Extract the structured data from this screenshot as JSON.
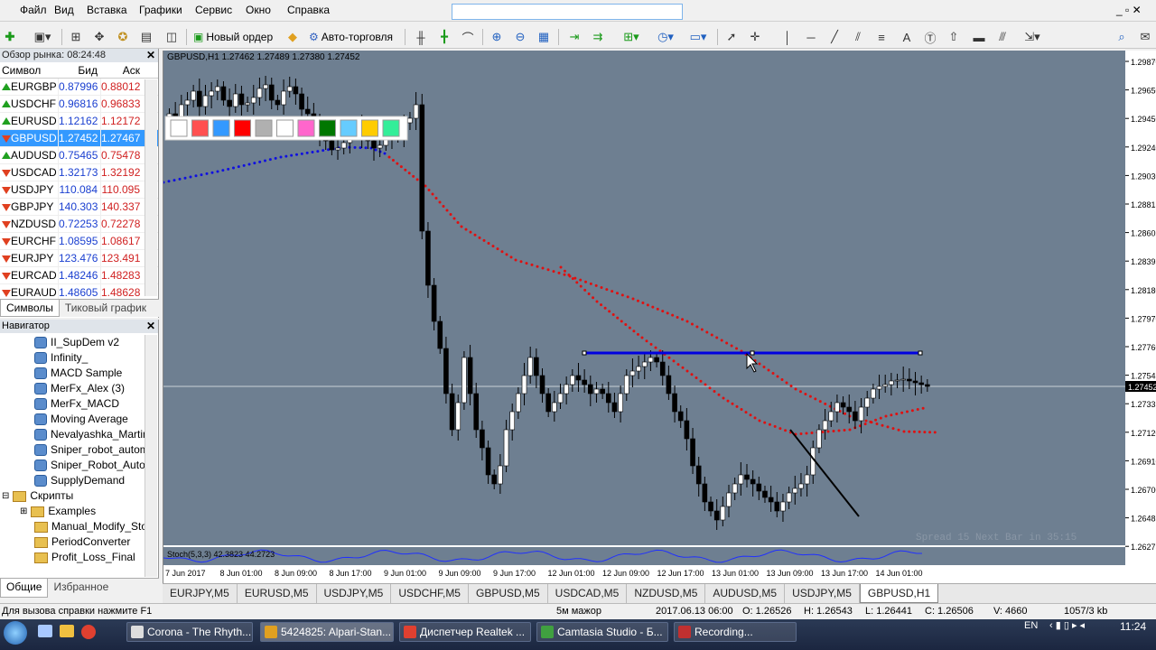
{
  "menu": [
    "Файл",
    "Вид",
    "Вставка",
    "Графики",
    "Сервис",
    "Окно",
    "Справка"
  ],
  "toolbar": {
    "new_order": "Новый ордер",
    "auto_trading": "Авто-торговля"
  },
  "market_watch": {
    "title": "Обзор рынка: 08:24:48",
    "col_symbol": "Символ",
    "col_bid": "Бид",
    "col_ask": "Аск",
    "rows": [
      {
        "sym": "EURGBP",
        "bid": "0.87996",
        "ask": "0.88012",
        "dir": "up"
      },
      {
        "sym": "USDCHF",
        "bid": "0.96816",
        "ask": "0.96833",
        "dir": "up"
      },
      {
        "sym": "EURUSD",
        "bid": "1.12162",
        "ask": "1.12172",
        "dir": "up"
      },
      {
        "sym": "GBPUSD",
        "bid": "1.27452",
        "ask": "1.27467",
        "dir": "dn"
      },
      {
        "sym": "AUDUSD",
        "bid": "0.75465",
        "ask": "0.75478",
        "dir": "up"
      },
      {
        "sym": "USDCAD",
        "bid": "1.32173",
        "ask": "1.32192",
        "dir": "dn"
      },
      {
        "sym": "USDJPY",
        "bid": "110.084",
        "ask": "110.095",
        "dir": "dn"
      },
      {
        "sym": "GBPJPY",
        "bid": "140.303",
        "ask": "140.337",
        "dir": "dn"
      },
      {
        "sym": "NZDUSD",
        "bid": "0.72253",
        "ask": "0.72278",
        "dir": "dn"
      },
      {
        "sym": "EURCHF",
        "bid": "1.08595",
        "ask": "1.08617",
        "dir": "dn"
      },
      {
        "sym": "EURJPY",
        "bid": "123.476",
        "ask": "123.491",
        "dir": "dn"
      },
      {
        "sym": "EURCAD",
        "bid": "1.48246",
        "ask": "1.48283",
        "dir": "dn"
      },
      {
        "sym": "EURAUD",
        "bid": "1.48605",
        "ask": "1.48628",
        "dir": "dn"
      }
    ],
    "tab_symbols": "Символы",
    "tab_tick": "Тиковый график"
  },
  "navigator": {
    "title": "Навигатор",
    "items": [
      "II_SupDem v2",
      "Infinity_",
      "MACD Sample",
      "MerFx_Alex (3)",
      "MerFx_MACD",
      "Moving Average",
      "Nevalyashka_Martin",
      "Sniper_robot_autom",
      "Sniper_Robot_Autor",
      "SupplyDemand"
    ],
    "scripts": "Скрипты",
    "script_items": [
      "Examples",
      "Manual_Modify_Sto",
      "PeriodConverter",
      "Profit_Loss_Final"
    ],
    "tab_common": "Общие",
    "tab_fav": "Избранное"
  },
  "chart": {
    "header": "GBPUSD,H1  1.27462 1.27489 1.27380 1.27452",
    "price_ticks": [
      "1.29870",
      "1.29650",
      "1.29450",
      "1.29240",
      "1.29030",
      "1.28815",
      "1.28605",
      "1.28395",
      "1.28180",
      "1.27970",
      "1.27760",
      "1.27545",
      "1.27335",
      "1.27120",
      "1.26910",
      "1.26700",
      "1.26485",
      "1.26275"
    ],
    "current_price": "1.27452",
    "time_ticks": [
      "7 Jun 2017",
      "8 Jun 01:00",
      "8 Jun 09:00",
      "8 Jun 17:00",
      "9 Jun 01:00",
      "9 Jun 09:00",
      "9 Jun 17:00",
      "12 Jun 01:00",
      "12 Jun 09:00",
      "12 Jun 17:00",
      "13 Jun 01:00",
      "13 Jun 09:00",
      "13 Jun 17:00",
      "14 Jun 01:00"
    ],
    "spread_text": "Spread  15  Next Bar in 35:15",
    "stoch_label": "Stoch(5,3,3) 42.3823 44.2723",
    "colors": {
      "bg": "#6e7f91",
      "red_ma": "#e01010",
      "blue_ma": "#1010e0",
      "hline": "#0000e0"
    }
  },
  "chart_tabs": [
    "EURJPY,M5",
    "EURUSD,M5",
    "USDJPY,M5",
    "USDCHF,M5",
    "GBPUSD,M5",
    "USDCAD,M5",
    "NZDUSD,M5",
    "AUDUSD,M5",
    "USDJPY,M5",
    "GBPUSD,H1"
  ],
  "status": {
    "help": "Для вызова справки нажмите F1",
    "profile": "5м мажор",
    "time": "2017.06.13 06:00",
    "o": "O: 1.26526",
    "h": "H: 1.26543",
    "l": "L: 1.26441",
    "c": "C: 1.26506",
    "v": "V: 4660",
    "traffic": "1057/3 kb"
  },
  "taskbar": {
    "tasks": [
      "Corona - The Rhyth...",
      "5424825: Alpari-Stan...",
      "Диспетчер Realtek ...",
      "Camtasia Studio - Б...",
      "Recording..."
    ],
    "lang": "EN",
    "clock": "11:24"
  }
}
